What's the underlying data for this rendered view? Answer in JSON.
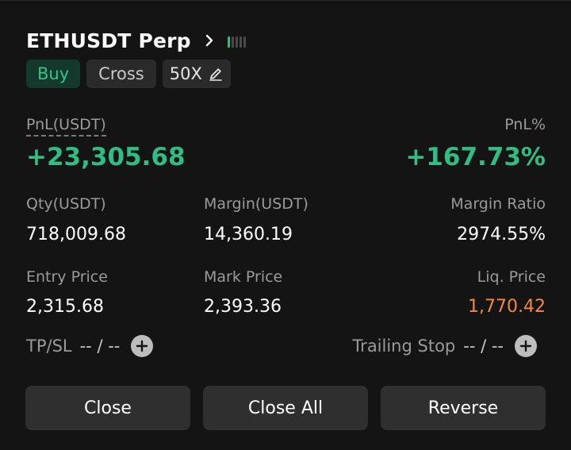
{
  "header": {
    "symbol": "ETHUSDT Perp",
    "signal_level": 0.2,
    "tags": {
      "side": "Buy",
      "margin_mode": "Cross",
      "leverage": "50X"
    }
  },
  "pnl": {
    "label": "PnL(USDT)",
    "value": "+23,305.68",
    "pct_label": "PnL%",
    "pct_value": "+167.73%"
  },
  "stats": {
    "qty_label": "Qty(USDT)",
    "qty_value": "718,009.68",
    "margin_label": "Margin(USDT)",
    "margin_value": "14,360.19",
    "ratio_label": "Margin Ratio",
    "ratio_value": "2974.55%",
    "entry_label": "Entry Price",
    "entry_value": "2,315.68",
    "mark_label": "Mark Price",
    "mark_value": "2,393.36",
    "liq_label": "Liq. Price",
    "liq_value": "1,770.42"
  },
  "tpsl": {
    "label": "TP/SL",
    "value": "-- / --"
  },
  "trailing": {
    "label": "Trailing Stop",
    "value": "-- / --"
  },
  "actions": {
    "close": "Close",
    "close_all": "Close All",
    "reverse": "Reverse"
  },
  "colors": {
    "profit": "#2fbd85",
    "liquidation": "#f28a3d",
    "buy_bg": "#12392b"
  }
}
